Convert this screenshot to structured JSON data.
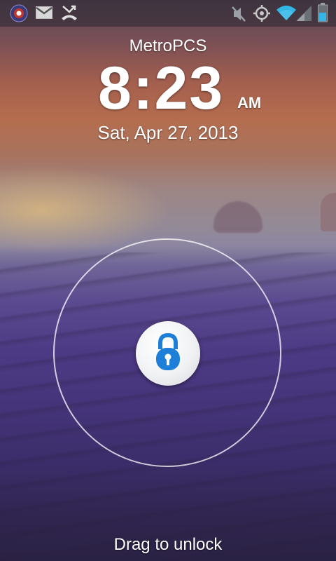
{
  "status_bar": {
    "left_icons": [
      "app-notification-icon",
      "gmail-icon",
      "missed-call-icon"
    ],
    "right_icons": [
      "mute-icon",
      "gps-icon",
      "wifi-icon",
      "signal-icon",
      "battery-icon"
    ]
  },
  "lockscreen": {
    "carrier": "MetroPCS",
    "time": "8:23",
    "ampm": "AM",
    "date": "Sat, Apr 27, 2013",
    "unlock_hint": "Drag to unlock"
  },
  "colors": {
    "lock_accent": "#1e7fd8",
    "ring": "#ffffff"
  }
}
